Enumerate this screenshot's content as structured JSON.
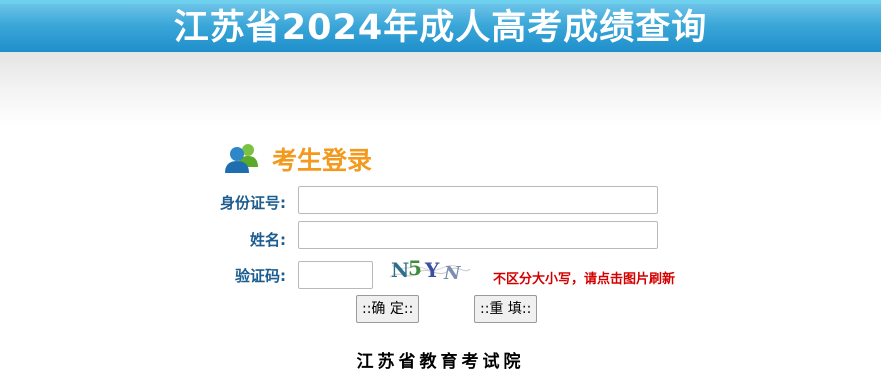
{
  "banner": {
    "title": "江苏省2024年成人高考成绩查询"
  },
  "login": {
    "title": "考生登录",
    "id_label": "身份证号:",
    "name_label": "姓名:",
    "captcha_label": "验证码:",
    "id_value": "",
    "name_value": "",
    "captcha_value": "",
    "captcha_text": "N5YN",
    "captcha_hint": "不区分大小写，请点击图片刷新",
    "confirm_label": "::确 定::",
    "reset_label": "::重 填::"
  },
  "footer": {
    "org": "江苏省教育考试院"
  },
  "colors": {
    "banner": "#2b9bd2",
    "login_title": "#f39a1e",
    "label": "#1c5d8f",
    "hint": "#d40000"
  },
  "icons": {
    "login_icon": "users-icon"
  }
}
